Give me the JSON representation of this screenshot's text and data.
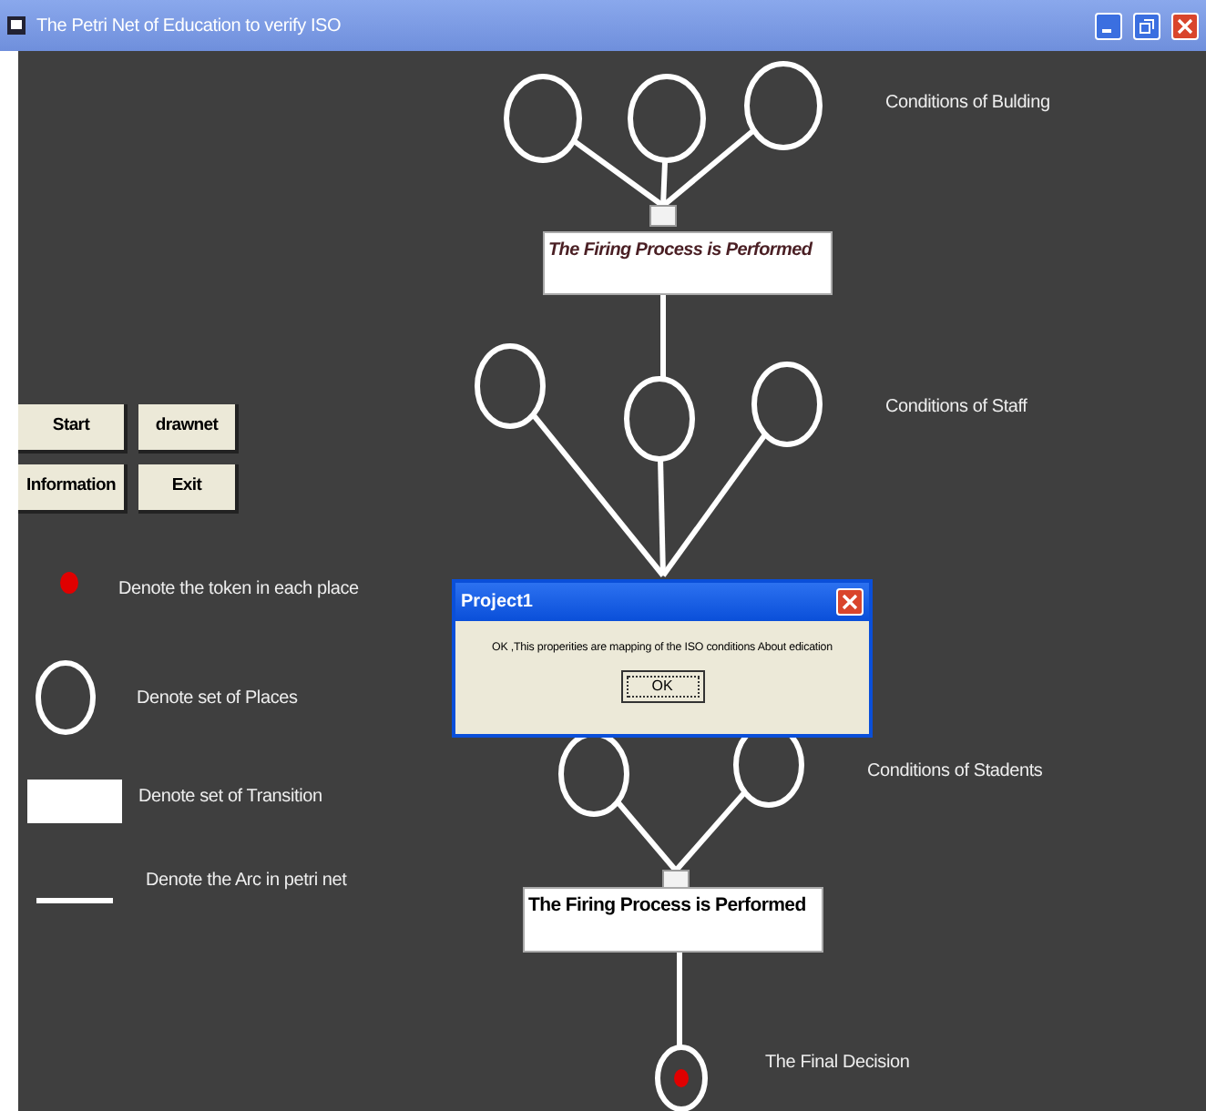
{
  "window": {
    "title": "The Petri Net of Education to verify  ISO"
  },
  "buttons": [
    {
      "label": "Start"
    },
    {
      "label": "drawnet"
    },
    {
      "label": "Information"
    },
    {
      "label": "Exit"
    }
  ],
  "legend": [
    {
      "kind": "token",
      "text": "Denote the  token in each place"
    },
    {
      "kind": "place",
      "text": "Denote set of Places"
    },
    {
      "kind": "transition",
      "text": "Denote set of Transition"
    },
    {
      "kind": "arc",
      "text": "Denote the Arc in petri net"
    }
  ],
  "diagram": {
    "stages": [
      {
        "label": "Conditions of Bulding",
        "places": [
          {
            "token": false
          },
          {
            "token": false
          },
          {
            "token": false
          }
        ],
        "transition": {
          "kind": "italic",
          "text": "The Firing Process is Performed"
        }
      },
      {
        "label": "Conditions of Staff",
        "places": [
          {
            "token": false
          },
          {
            "token": false
          },
          {
            "token": false
          }
        ]
      },
      {
        "label": "Conditions of Stadents",
        "places": [
          {
            "token": false
          },
          {
            "token": false
          }
        ],
        "transition": {
          "kind": "plain",
          "text": "The Firing Process is Performed"
        }
      }
    ],
    "final": {
      "label": "The Final Decision",
      "token": true
    }
  },
  "dialog": {
    "title": "Project1",
    "message": "OK ,This properities are mapping of the ISO conditions About edication",
    "button": "OK"
  }
}
